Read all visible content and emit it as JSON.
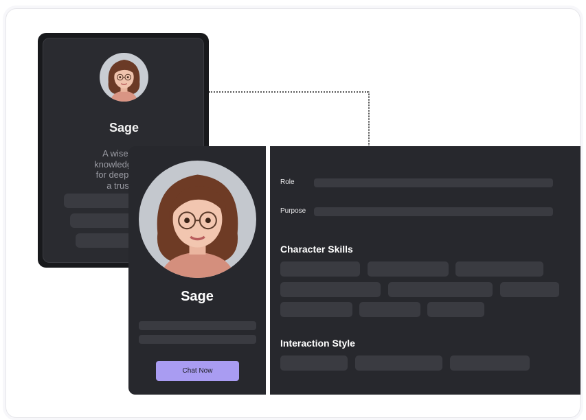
{
  "back_card": {
    "name": "Sage",
    "description_lines": [
      "A wise and",
      "knowledgeable",
      "for deep discu",
      "a trusted"
    ]
  },
  "front_card": {
    "name": "Sage",
    "chat_button_label": "Chat Now"
  },
  "details": {
    "role_label": "Role",
    "purpose_label": "Purpose",
    "skills_title": "Character Skills",
    "interaction_title": "Interaction Style"
  },
  "colors": {
    "accent": "#a99cf2",
    "panel": "#27282d",
    "placeholder": "#3a3b41"
  }
}
